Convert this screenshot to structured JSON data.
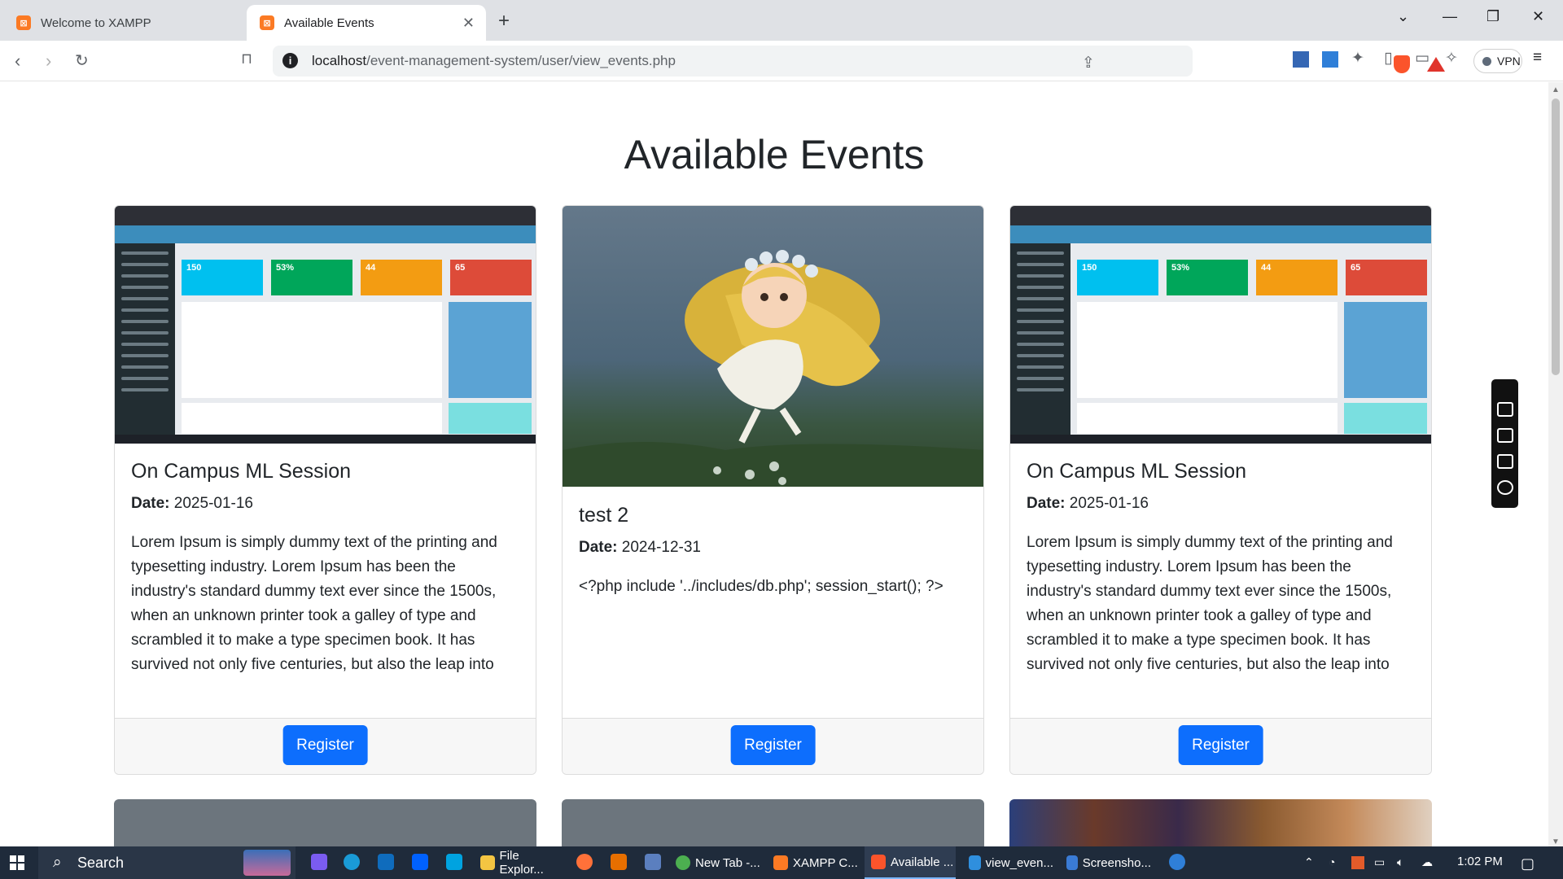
{
  "browser": {
    "tabs": [
      {
        "title": "Welcome to XAMPP",
        "active": false
      },
      {
        "title": "Available Events",
        "active": true
      }
    ],
    "url_host": "localhost",
    "url_path": "/event-management-system/user/view_events.php",
    "vpn_label": "VPN"
  },
  "page": {
    "heading": "Available Events",
    "cards": [
      {
        "title": "On Campus ML Session",
        "date_label": "Date:",
        "date": "2025-01-16",
        "description": "Lorem Ipsum is simply dummy text of the printing and typesetting industry. Lorem Ipsum has been the industry's standard dummy text ever since the 1500s, when an unknown printer took a galley of type and scrambled it to make a type specimen book. It has survived not only five centuries, but also the leap into electronic typesetting, remaining essentially unchange",
        "button": "Register",
        "image": "dashboard-screenshot"
      },
      {
        "title": "test 2",
        "date_label": "Date:",
        "date": "2024-12-31",
        "description": "<?php include '../includes/db.php'; session_start(); ?>",
        "button": "Register",
        "image": "anime-girl-illustration"
      },
      {
        "title": "On Campus ML Session",
        "date_label": "Date:",
        "date": "2025-01-16",
        "description": "Lorem Ipsum is simply dummy text of the printing and typesetting industry. Lorem Ipsum has been the industry's standard dummy text ever since the 1500s, when an unknown printer took a galley of type and scrambled it to make a type specimen book. It has survived not only five centuries, but also the leap into electronic typesetting, remaining essentially unchange",
        "button": "Register",
        "image": "dashboard-screenshot"
      }
    ],
    "thumbnail": {
      "stats": [
        "150",
        "53%",
        "44",
        "65"
      ],
      "colors": [
        "#00c0ef",
        "#00a65a",
        "#f39c12",
        "#dd4b39"
      ]
    }
  },
  "taskbar": {
    "search_label": "Search",
    "apps": [
      {
        "label": "File Explor...",
        "icon": "folder-icon"
      },
      {
        "label": "New Tab -...",
        "icon": "chrome-icon"
      },
      {
        "label": "XAMPP C...",
        "icon": "xampp-icon"
      },
      {
        "label": "Available ...",
        "icon": "brave-icon"
      },
      {
        "label": "view_even...",
        "icon": "vscode-icon"
      },
      {
        "label": "Screensho...",
        "icon": "snipping-tool-icon"
      }
    ],
    "time": "1:02 PM"
  }
}
